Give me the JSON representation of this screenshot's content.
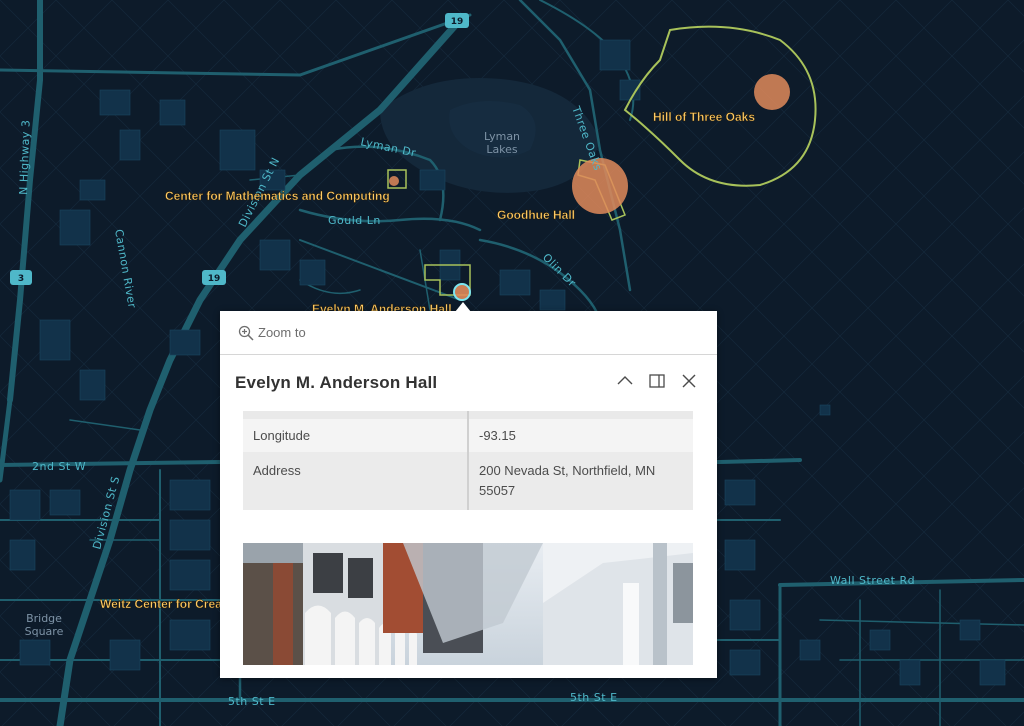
{
  "map": {
    "streets": {
      "highway": "N Highway 3",
      "division_n": "Division St N",
      "division_s": "Division St S",
      "cannon_river": "Cannon River",
      "lyman_dr": "Lyman Dr",
      "gould_ln": "Gould Ln",
      "three_oaks": "Three Oaks",
      "olin_dr": "Olin Dr",
      "second_st": "2nd St W",
      "wall_st": "Wall Street Rd",
      "fifth_st_e_1": "5th St E",
      "fifth_st_e_2": "5th St E"
    },
    "areas": {
      "lyman_lakes_1": "Lyman",
      "lyman_lakes_2": "Lakes",
      "bridge_square_1": "Bridge",
      "bridge_square_2": "Square"
    },
    "shields": {
      "route_19_top": "19",
      "route_19_mid": "19",
      "route_3": "3"
    },
    "pois": {
      "hill": "Hill of Three Oaks",
      "cmc": "Center for Mathematics and Computing",
      "goodhue": "Goodhue Hall",
      "anderson": "Evelyn M. Anderson Hall",
      "weitz": "Weitz Center for Crea"
    },
    "colors": {
      "background": "#0d1b2a",
      "roads": "#1f5f6e",
      "poi_label": "#ffcc66",
      "marker": "#e08a5a",
      "outline": "#a8c25a"
    }
  },
  "popup": {
    "zoom_label": "Zoom to",
    "zoom_icon": "zoom-in-icon",
    "title": "Evelyn M. Anderson Hall",
    "buttons": [
      "collapse-icon",
      "dock-icon",
      "close-icon"
    ],
    "attributes": [
      {
        "key": "Longitude",
        "value": "-93.15"
      },
      {
        "key": "Address",
        "value_line1": "200 Nevada St, Northfield, MN",
        "value_line2": "55057"
      }
    ]
  }
}
